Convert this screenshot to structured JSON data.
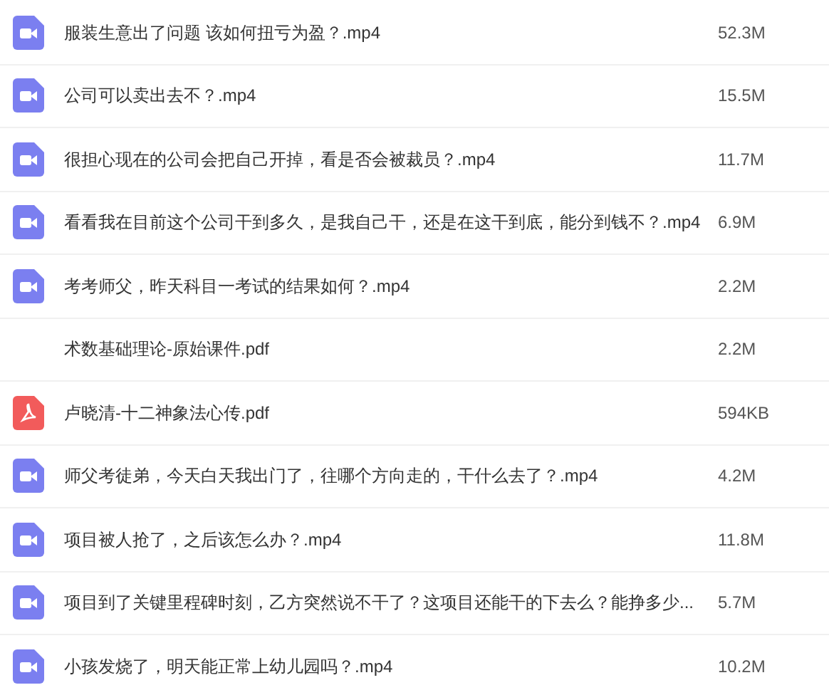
{
  "files": [
    {
      "kind": "video",
      "name": "服装生意出了问题 该如何扭亏为盈？.mp4",
      "size": "52.3M"
    },
    {
      "kind": "video",
      "name": "公司可以卖出去不？.mp4",
      "size": "15.5M"
    },
    {
      "kind": "video",
      "name": "很担心现在的公司会把自己开掉，看是否会被裁员？.mp4",
      "size": "11.7M"
    },
    {
      "kind": "video",
      "name": "看看我在目前这个公司干到多久，是我自己干，还是在这干到底，能分到钱不？.mp4",
      "size": "6.9M"
    },
    {
      "kind": "video",
      "name": "考考师父，昨天科目一考试的结果如何？.mp4",
      "size": "2.2M"
    },
    {
      "kind": "hidden",
      "name": "术数基础理论-原始课件.pdf",
      "size": "2.2M"
    },
    {
      "kind": "pdf",
      "name": "卢晓清-十二神象法心传.pdf",
      "size": "594KB"
    },
    {
      "kind": "video",
      "name": "师父考徒弟，今天白天我出门了，往哪个方向走的，干什么去了？.mp4",
      "size": "4.2M"
    },
    {
      "kind": "video",
      "name": "项目被人抢了，之后该怎么办？.mp4",
      "size": "11.8M"
    },
    {
      "kind": "video",
      "name": "项目到了关键里程碑时刻，乙方突然说不干了？这项目还能干的下去么？能挣多少...",
      "size": "5.7M"
    },
    {
      "kind": "video",
      "name": "小孩发烧了，明天能正常上幼儿园吗？.mp4",
      "size": "10.2M"
    }
  ]
}
